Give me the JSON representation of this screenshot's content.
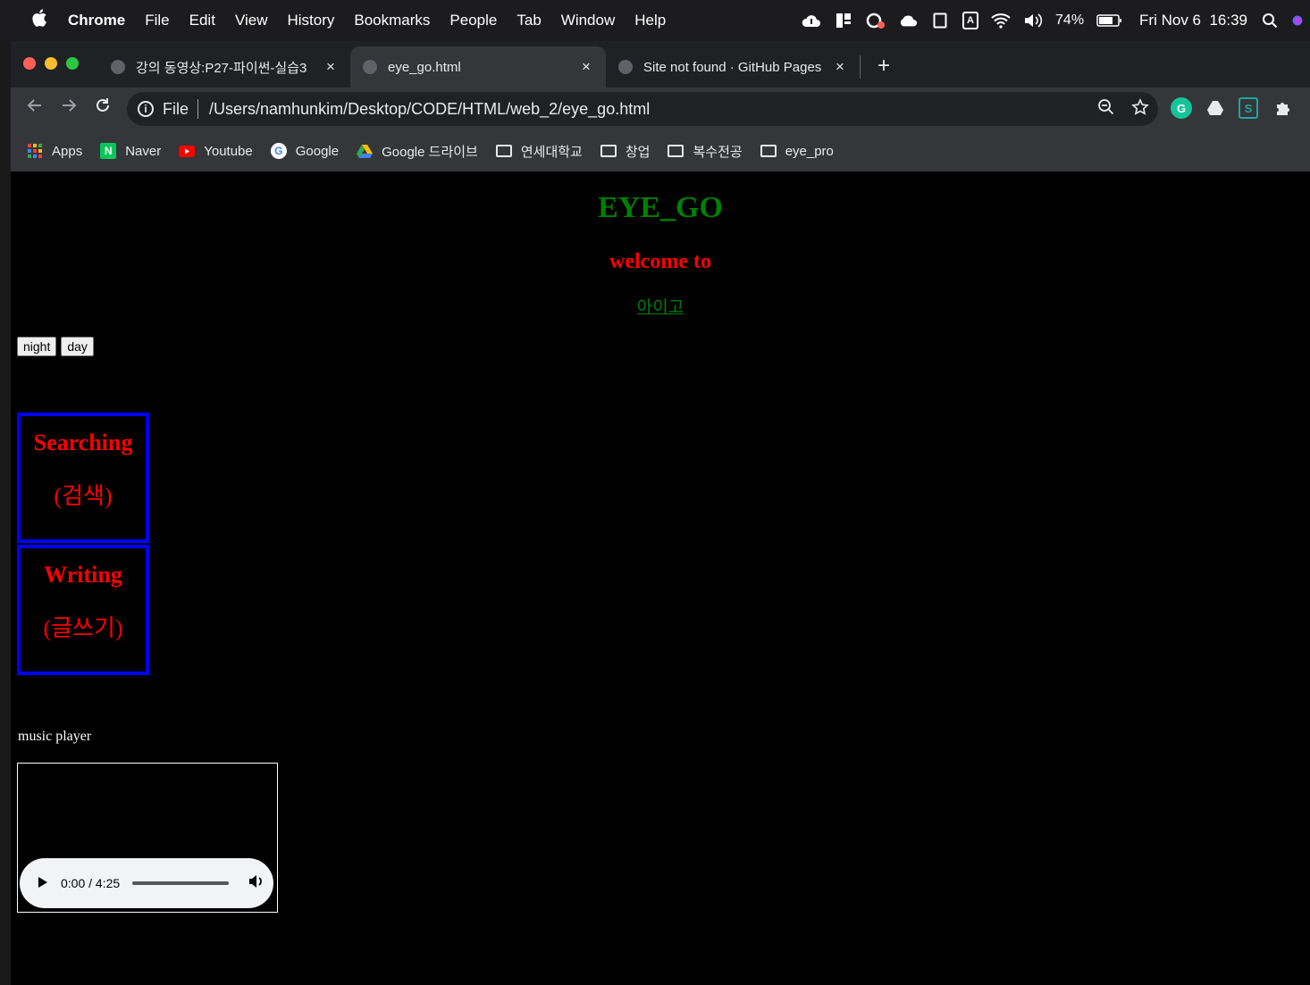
{
  "menubar": {
    "apple": "",
    "app_name": "Chrome",
    "items": [
      "File",
      "Edit",
      "View",
      "History",
      "Bookmarks",
      "People",
      "Tab",
      "Window",
      "Help"
    ],
    "battery": "74%",
    "datetime": "Fri Nov 6  16:39",
    "input_indicator": "A"
  },
  "browser": {
    "tabs": [
      {
        "title": "강의 동영상:P27-파이썬-실습3",
        "close": "×"
      },
      {
        "title": "eye_go.html",
        "close": "×"
      },
      {
        "title": "Site not found · GitHub Pages",
        "close": "×"
      }
    ],
    "new_tab": "+",
    "omnibox": {
      "scheme": "File",
      "url": "/Users/namhunkim/Desktop/CODE/HTML/web_2/eye_go.html"
    },
    "bookmarks": [
      {
        "label": "Apps",
        "icon": "apps-grid-icon"
      },
      {
        "label": "Naver",
        "icon": "naver-icon"
      },
      {
        "label": "Youtube",
        "icon": "youtube-icon"
      },
      {
        "label": "Google",
        "icon": "google-icon"
      },
      {
        "label": "Google 드라이브",
        "icon": "google-drive-icon"
      },
      {
        "label": "연세대학교",
        "icon": "folder-icon"
      },
      {
        "label": "창업",
        "icon": "folder-icon"
      },
      {
        "label": "복수전공",
        "icon": "folder-icon"
      },
      {
        "label": "eye_pro",
        "icon": "folder-icon"
      }
    ]
  },
  "page": {
    "title": "EYE_GO",
    "subtitle": "welcome to",
    "link": "아이고",
    "night_button": "night",
    "day_button": "day",
    "searching": {
      "title": "Searching",
      "sub": "(검색)"
    },
    "writing": {
      "title": "Writing",
      "sub": "(글쓰기)"
    },
    "music_label": "music player",
    "audio": {
      "time": "0:00 / 4:25"
    }
  },
  "colors": {
    "page_bg": "#000000",
    "title_green": "#008000",
    "subtitle_red": "#ff0000",
    "box_blue": "#0000ff"
  }
}
